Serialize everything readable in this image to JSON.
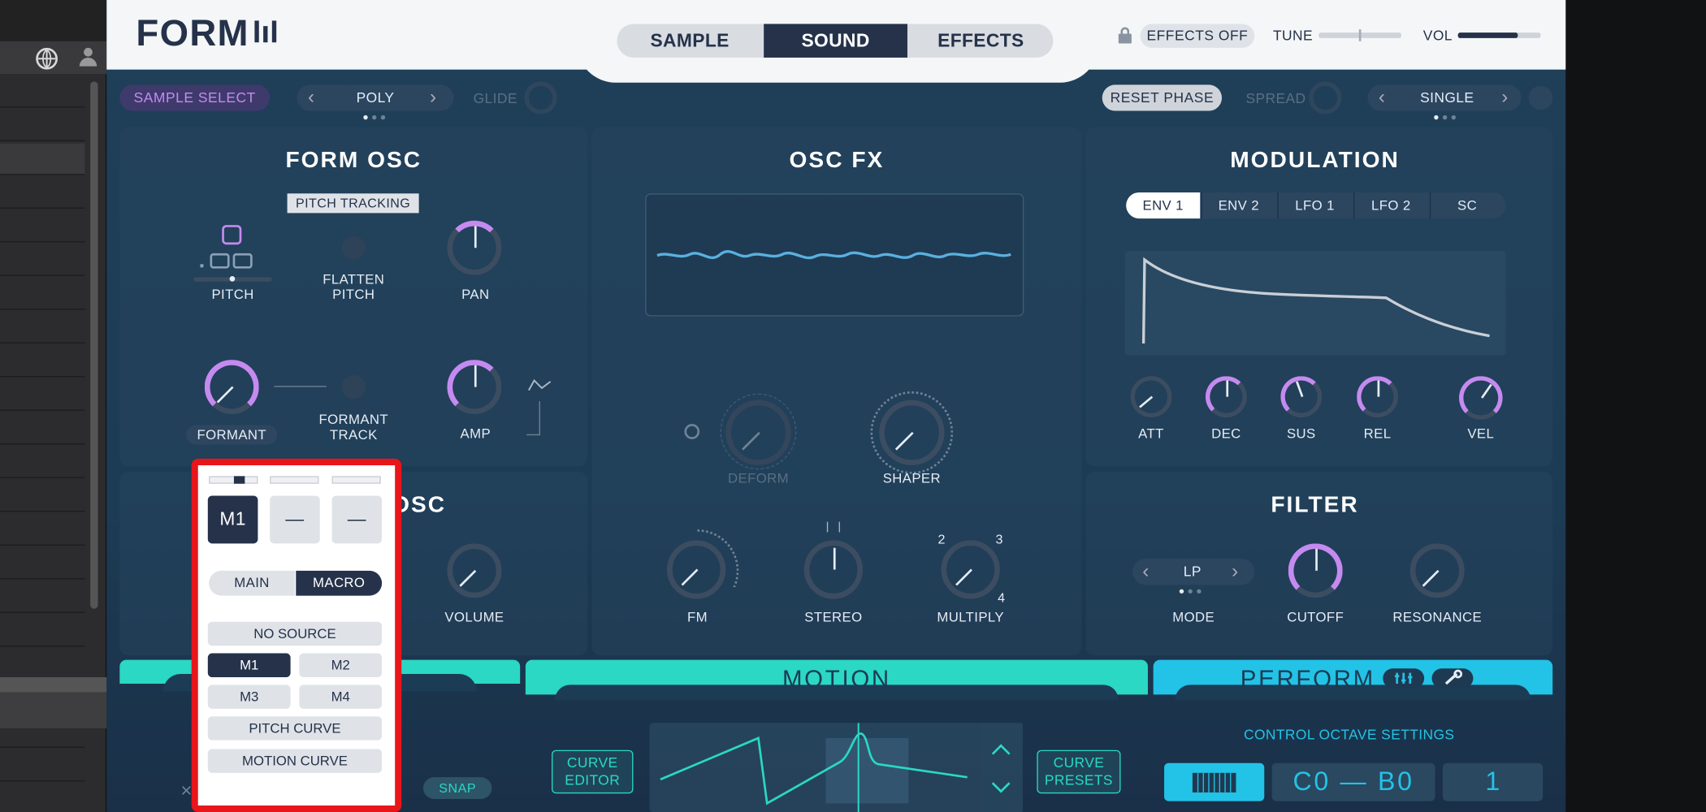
{
  "header": {
    "logo": "FORM",
    "tabs": [
      "SAMPLE",
      "SOUND",
      "EFFECTS"
    ],
    "active_tab": "SOUND",
    "effects_off": "EFFECTS OFF",
    "tune": "TUNE",
    "vol": "VOL",
    "vol_level": 0.72
  },
  "toolbar": {
    "sample_select": "SAMPLE SELECT",
    "poly": "POLY",
    "glide": "GLIDE",
    "reset_phase": "RESET PHASE",
    "spread": "SPREAD",
    "single": "SINGLE",
    "prev": "‹",
    "next": "›"
  },
  "form_osc": {
    "title": "FORM OSC",
    "pitch_tracking": "PITCH TRACKING",
    "pitch": "PITCH",
    "flatten_pitch": "FLATTEN PITCH",
    "pan": "PAN",
    "formant": "FORMANT",
    "formant_track": "FORMANT TRACK",
    "amp": "AMP"
  },
  "osc_fx": {
    "title": "OSC FX",
    "deform": "DEFORM",
    "shaper": "SHAPER",
    "fm": "FM",
    "stereo": "STEREO",
    "multiply": "MULTIPLY",
    "mult_2": "2",
    "mult_3": "3",
    "mult_4": "4"
  },
  "modulation": {
    "title": "MODULATION",
    "tabs": [
      "ENV 1",
      "ENV 2",
      "LFO 1",
      "LFO 2",
      "SC"
    ],
    "active_tab": "ENV 1",
    "knobs": [
      "ATT",
      "DEC",
      "SUS",
      "REL",
      "VEL"
    ]
  },
  "sub_osc": {
    "title_partial": "OSC",
    "volume": "VOLUME"
  },
  "filter": {
    "title": "FILTER",
    "mode_value": "LP",
    "mode": "MODE",
    "cutoff": "CUTOFF",
    "resonance": "RESONANCE"
  },
  "bottom": {
    "motion": "MOTION",
    "perform": "PERFORM",
    "curve_editor": "CURVE EDITOR",
    "curve_presets": "CURVE PRESETS",
    "snap": "SNAP",
    "control_octave": "CONTROL OCTAVE SETTINGS",
    "octave_range": "C0 — B0",
    "octave_value": "1"
  },
  "popup": {
    "slot1": "M1",
    "slot2": "—",
    "slot3": "—",
    "main": "MAIN",
    "macro": "MACRO",
    "no_source": "NO SOURCE",
    "m1": "M1",
    "m2": "M2",
    "m3": "M3",
    "m4": "M4",
    "pitch_curve": "PITCH CURVE",
    "motion_curve": "MOTION CURVE"
  },
  "colors": {
    "accent_purple": "#c58af0",
    "accent_teal": "#2ad8c4",
    "accent_cyan": "#22c3e6",
    "highlight_red": "#e8151b",
    "navy": "#25324a"
  }
}
